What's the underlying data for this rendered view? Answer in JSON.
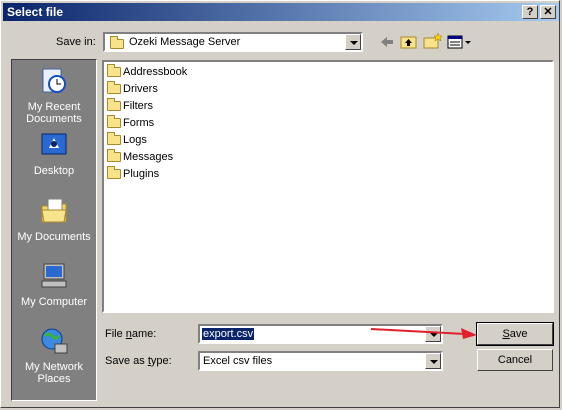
{
  "window": {
    "title": "Select file",
    "help_label": "?",
    "close_label": "✕"
  },
  "toolbar": {
    "savein_label": "Save in:",
    "savein_value": "Ozeki Message Server"
  },
  "places": [
    {
      "label_line1": "My Recent",
      "label_line2": "Documents"
    },
    {
      "label_line1": "Desktop",
      "label_line2": ""
    },
    {
      "label_line1": "My Documents",
      "label_line2": ""
    },
    {
      "label_line1": "My Computer",
      "label_line2": ""
    },
    {
      "label_line1": "My Network",
      "label_line2": "Places"
    }
  ],
  "files": [
    "Addressbook",
    "Drivers",
    "Filters",
    "Forms",
    "Logs",
    "Messages",
    "Plugins"
  ],
  "form": {
    "filename_label_pre": "File ",
    "filename_label_u": "n",
    "filename_label_post": "ame:",
    "filename_value": "export.csv",
    "savetype_label_pre": "Save as ",
    "savetype_label_u": "t",
    "savetype_label_post": "ype:",
    "savetype_value": "Excel csv files",
    "save_u": "S",
    "save_rest": "ave",
    "cancel_label": "Cancel"
  },
  "colors": {
    "title_start": "#0a246a",
    "title_end": "#a6caf0",
    "arrow": "#e0202a",
    "face": "#d4d0c8"
  }
}
